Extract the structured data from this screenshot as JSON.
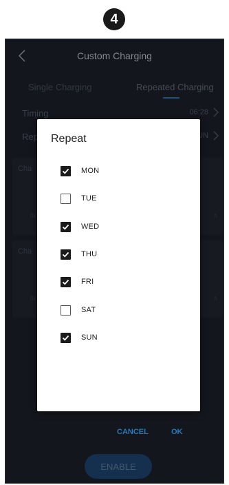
{
  "step_badge": "4",
  "header": {
    "title": "Custom Charging"
  },
  "tabs": [
    {
      "label": "Single Charging"
    },
    {
      "label": "Repeated Charging"
    }
  ],
  "settings": {
    "timing": {
      "label": "Timing",
      "value": "06:28"
    },
    "repeat": {
      "label": "Rep",
      "value": "UN"
    }
  },
  "cards": [
    {
      "label": "Cha",
      "tick_left": "0k",
      "tick_right": "h"
    },
    {
      "label": "Cha",
      "tick_left": "0k",
      "tick_right": "h"
    }
  ],
  "enable_button": "ENABLE",
  "dialog": {
    "title": "Repeat",
    "options": [
      {
        "label": "MON",
        "checked": true
      },
      {
        "label": "TUE",
        "checked": false
      },
      {
        "label": "WED",
        "checked": true
      },
      {
        "label": "THU",
        "checked": true
      },
      {
        "label": "FRI",
        "checked": true
      },
      {
        "label": "SAT",
        "checked": false
      },
      {
        "label": "SUN",
        "checked": true
      }
    ],
    "cancel": "CANCEL",
    "ok": "OK"
  }
}
